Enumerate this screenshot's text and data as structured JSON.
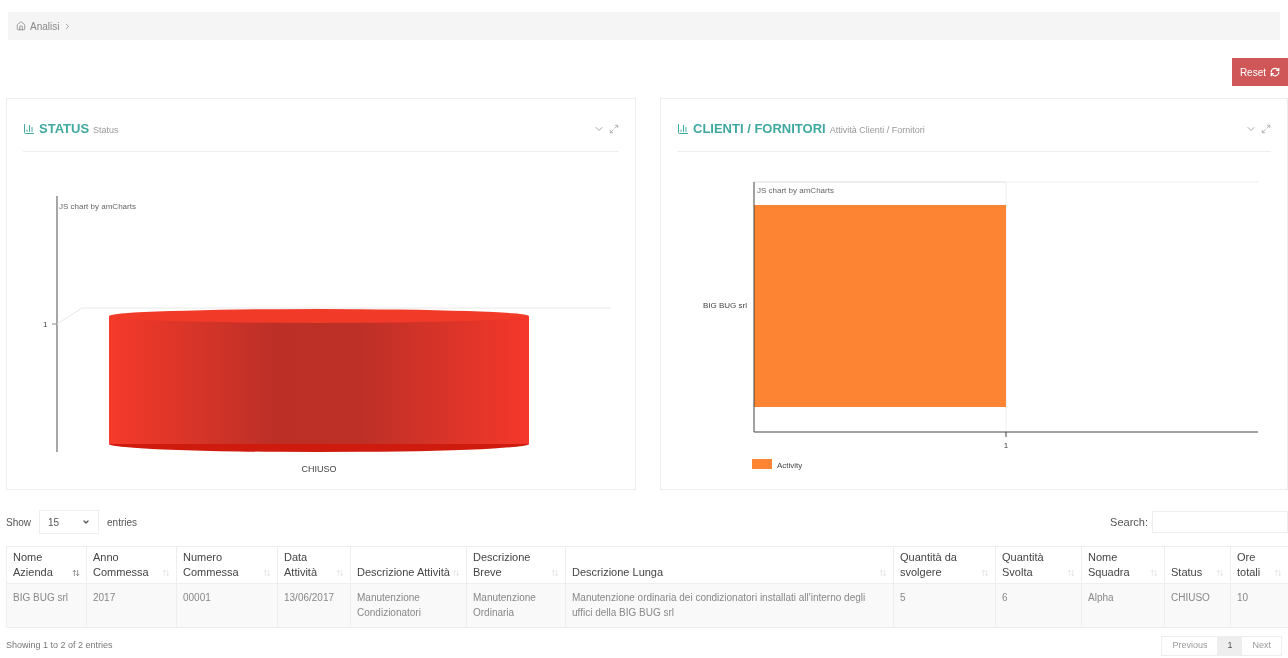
{
  "breadcrumb": {
    "items": [
      "Analisi"
    ]
  },
  "reset_button": {
    "label": "Reset"
  },
  "panels": [
    {
      "title": "STATUS",
      "subtitle": "Status",
      "chart": {
        "kind": "cylinder",
        "credit": "JS chart by amCharts",
        "tick_label": "1",
        "category_label": "CHIUSO"
      }
    },
    {
      "title": "CLIENTI / FORNITORI",
      "subtitle": "Attività Clienti / Fornitori",
      "chart": {
        "kind": "horizontal-bar",
        "credit": "JS chart by amCharts",
        "tick_label": "1",
        "category_label": "BIG BUG srl",
        "legend": "Activity"
      }
    }
  ],
  "table_controls": {
    "show_label": "Show",
    "page_size": "15",
    "entries_label": "entries",
    "search_label": "Search:"
  },
  "table": {
    "columns": [
      {
        "label": "Nome Azienda",
        "sorted": true
      },
      {
        "label": "Anno Commessa",
        "sorted": false
      },
      {
        "label": "Numero Commessa",
        "sorted": false
      },
      {
        "label": "Data Attività",
        "sorted": false
      },
      {
        "label": "Descrizione Attività",
        "sorted": false
      },
      {
        "label": "Descrizione Breve",
        "sorted": false
      },
      {
        "label": "Descrizione Lunga",
        "sorted": false
      },
      {
        "label": "Quantità da svolgere",
        "sorted": false
      },
      {
        "label": "Quantità Svolta",
        "sorted": false
      },
      {
        "label": "Nome Squadra",
        "sorted": false
      },
      {
        "label": "Status",
        "sorted": false
      },
      {
        "label": "Ore totali",
        "sorted": false
      }
    ],
    "rows": [
      [
        "BIG BUG srl",
        "2017",
        "00001",
        "13/06/2017",
        "Manutenzione Condizionatori",
        "Manutenzione Ordinaria",
        "Manutenzione ordinaria dei condizionatori installati all'interno degli uffici della BIG BUG srl",
        "5",
        "6",
        "Alpha",
        "CHIUSO",
        "10"
      ]
    ]
  },
  "footer": {
    "info": "Showing 1 to 2 of 2 entries",
    "pages": [
      {
        "label": "Previous",
        "selected": false
      },
      {
        "label": "1",
        "selected": true
      },
      {
        "label": "Next",
        "selected": false
      }
    ]
  }
}
